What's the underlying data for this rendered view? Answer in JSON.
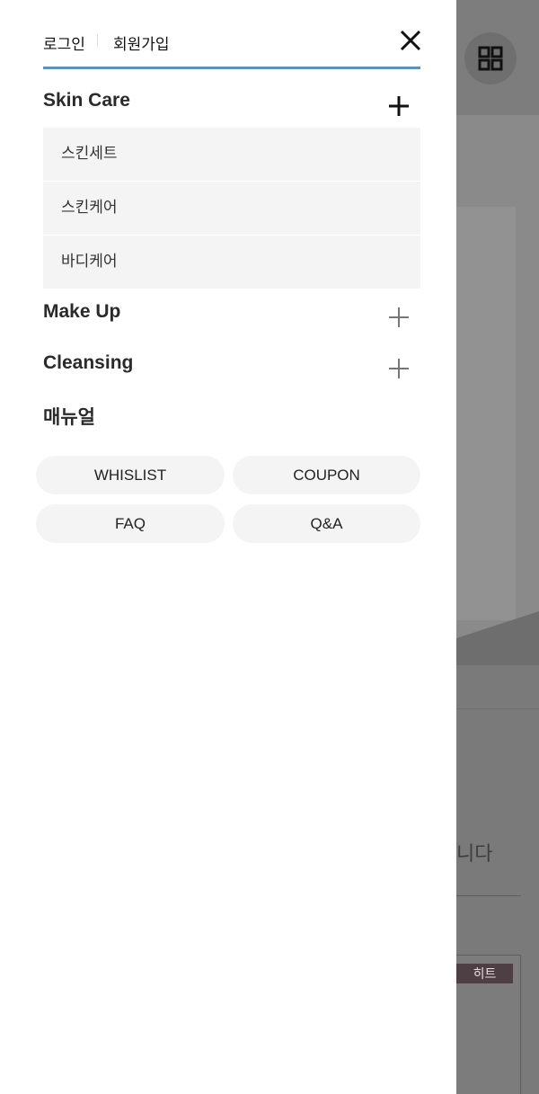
{
  "drawer": {
    "auth": {
      "login": "로그인",
      "join": "회원가입"
    },
    "categories": [
      {
        "title": "Skin Care",
        "items": [
          "스킨세트",
          "스킨케어",
          "바디케어"
        ]
      },
      {
        "title": "Make Up"
      },
      {
        "title": "Cleansing"
      },
      {
        "title": "매뉴얼"
      }
    ],
    "buttons": [
      "WHISLIST",
      "COUPON",
      "FAQ",
      "Q&A"
    ]
  },
  "background": {
    "text_fragment": "니다",
    "badge": "히트"
  },
  "colors": {
    "accent_line": "#5d93bb",
    "submenu_bg": "#f4f4f4",
    "pill_bg": "#f4f4f4"
  },
  "icons": {
    "close": "close-icon",
    "expand": "plus-icon",
    "grid": "grid-icon"
  }
}
